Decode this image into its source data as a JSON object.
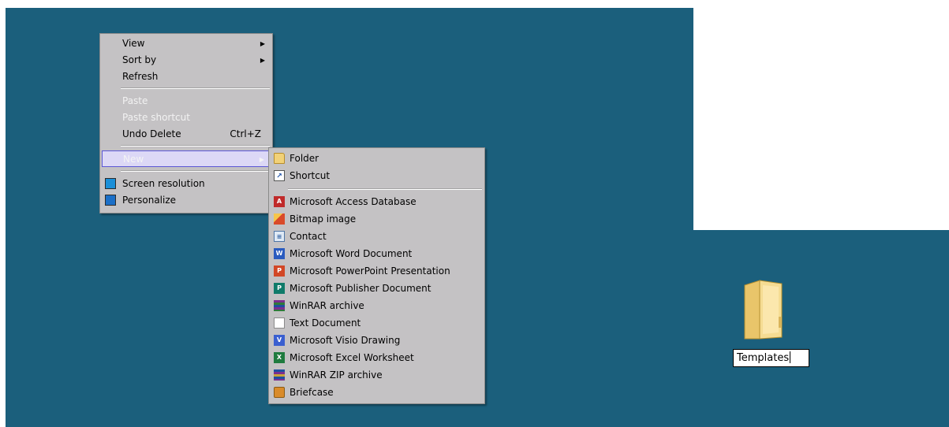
{
  "desktop": {
    "background_color": "#1b5f7c",
    "folder": {
      "name_value": "Templates",
      "icon": "folder-icon"
    }
  },
  "context_menu": {
    "items": [
      {
        "label": "View",
        "has_submenu": true
      },
      {
        "label": "Sort by",
        "has_submenu": true
      },
      {
        "label": "Refresh"
      },
      {
        "label": "Paste",
        "disabled": true
      },
      {
        "label": "Paste shortcut",
        "disabled": true
      },
      {
        "label": "Undo Delete",
        "shortcut": "Ctrl+Z"
      },
      {
        "label": "New",
        "has_submenu": true,
        "highlighted": true
      },
      {
        "label": "Screen resolution",
        "icon": "monitor-icon"
      },
      {
        "label": "Personalize",
        "icon": "personalize-icon"
      }
    ]
  },
  "new_submenu": {
    "items": [
      {
        "label": "Folder",
        "icon": "folder-icon"
      },
      {
        "label": "Shortcut",
        "icon": "shortcut-icon"
      },
      {
        "label": "Microsoft Access Database",
        "icon": "access-icon"
      },
      {
        "label": "Bitmap image",
        "icon": "bitmap-icon"
      },
      {
        "label": "Contact",
        "icon": "contact-icon"
      },
      {
        "label": "Microsoft Word Document",
        "icon": "word-icon"
      },
      {
        "label": "Microsoft PowerPoint Presentation",
        "icon": "powerpoint-icon"
      },
      {
        "label": "Microsoft Publisher Document",
        "icon": "publisher-icon"
      },
      {
        "label": "WinRAR archive",
        "icon": "winrar-icon"
      },
      {
        "label": "Text Document",
        "icon": "text-document-icon"
      },
      {
        "label": "Microsoft Visio Drawing",
        "icon": "visio-icon"
      },
      {
        "label": "Microsoft Excel Worksheet",
        "icon": "excel-icon"
      },
      {
        "label": "WinRAR ZIP archive",
        "icon": "winrar-zip-icon"
      },
      {
        "label": "Briefcase",
        "icon": "briefcase-icon"
      }
    ]
  }
}
